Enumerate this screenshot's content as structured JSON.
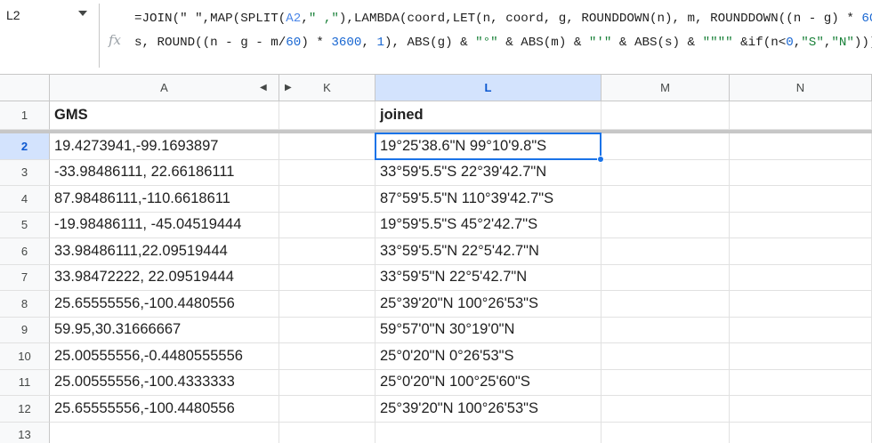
{
  "formula_bar": {
    "name_box": "L2",
    "fx_label": "fx",
    "lines": [
      [
        {
          "t": "=JOIN(\" \",MAP(SPLIT(",
          "c": ""
        },
        {
          "t": "A2",
          "c": "ref"
        },
        {
          "t": ",",
          "c": ""
        },
        {
          "t": "\" ,\"",
          "c": "str"
        },
        {
          "t": "),LAMBDA(coord,LET(n, coord, g, ROUNDDOWN(n), m, ROUNDDOWN((n - g) * ",
          "c": ""
        },
        {
          "t": "60",
          "c": "num"
        },
        {
          "t": "),",
          "c": ""
        }
      ],
      [
        {
          "t": "s, ROUND((n - g - m/",
          "c": ""
        },
        {
          "t": "60",
          "c": "num"
        },
        {
          "t": ") * ",
          "c": ""
        },
        {
          "t": "3600",
          "c": "num"
        },
        {
          "t": ", ",
          "c": ""
        },
        {
          "t": "1",
          "c": "num"
        },
        {
          "t": "), ABS(g) & ",
          "c": ""
        },
        {
          "t": "\"°\"",
          "c": "str"
        },
        {
          "t": " & ABS(m) & ",
          "c": ""
        },
        {
          "t": "\"'\"",
          "c": "str"
        },
        {
          "t": " & ABS(s) & ",
          "c": ""
        },
        {
          "t": "\"\"\"\"",
          "c": "str"
        },
        {
          "t": " &if(n<",
          "c": ""
        },
        {
          "t": "0",
          "c": "num"
        },
        {
          "t": ",",
          "c": ""
        },
        {
          "t": "\"S\"",
          "c": "str"
        },
        {
          "t": ",",
          "c": ""
        },
        {
          "t": "\"N\"",
          "c": "str"
        },
        {
          "t": ")))))",
          "c": ""
        }
      ]
    ]
  },
  "columns": [
    {
      "label": "A",
      "selected": false
    },
    {
      "label": "K",
      "selected": false
    },
    {
      "label": "L",
      "selected": true
    },
    {
      "label": "M",
      "selected": false
    },
    {
      "label": "N",
      "selected": false
    }
  ],
  "active_cell": "L2",
  "rows": [
    {
      "num": "1",
      "a": "GMS",
      "l": "joined",
      "header": true
    },
    {
      "num": "2",
      "a": "19.4273941,-99.1693897",
      "l": "19°25'38.6\"N 99°10'9.8\"S"
    },
    {
      "num": "3",
      "a": "-33.98486111, 22.66186111",
      "l": "33°59'5.5\"S 22°39'42.7\"N"
    },
    {
      "num": "4",
      "a": "87.98486111,-110.6618611",
      "l": "87°59'5.5\"N 110°39'42.7\"S"
    },
    {
      "num": "5",
      "a": "-19.98486111, -45.04519444",
      "l": "19°59'5.5\"S 45°2'42.7\"S"
    },
    {
      "num": "6",
      "a": "33.98486111,22.09519444",
      "l": "33°59'5.5\"N 22°5'42.7\"N"
    },
    {
      "num": "7",
      "a": "33.98472222, 22.09519444",
      "l": "33°59'5\"N 22°5'42.7\"N"
    },
    {
      "num": "8",
      "a": "25.65555556,-100.4480556",
      "l": "25°39'20\"N 100°26'53\"S"
    },
    {
      "num": "9",
      "a": "59.95,30.31666667",
      "l": "59°57'0\"N 30°19'0\"N"
    },
    {
      "num": "10",
      "a": "25.00555556,-0.4480555556",
      "l": "25°0'20\"N 0°26'53\"S"
    },
    {
      "num": "11",
      "a": "25.00555556,-100.4333333",
      "l": "25°0'20\"N 100°25'60\"S"
    },
    {
      "num": "12",
      "a": "25.65555556,-100.4480556",
      "l": "25°39'20\"N 100°26'53\"S"
    },
    {
      "num": "13",
      "a": "",
      "l": ""
    }
  ]
}
